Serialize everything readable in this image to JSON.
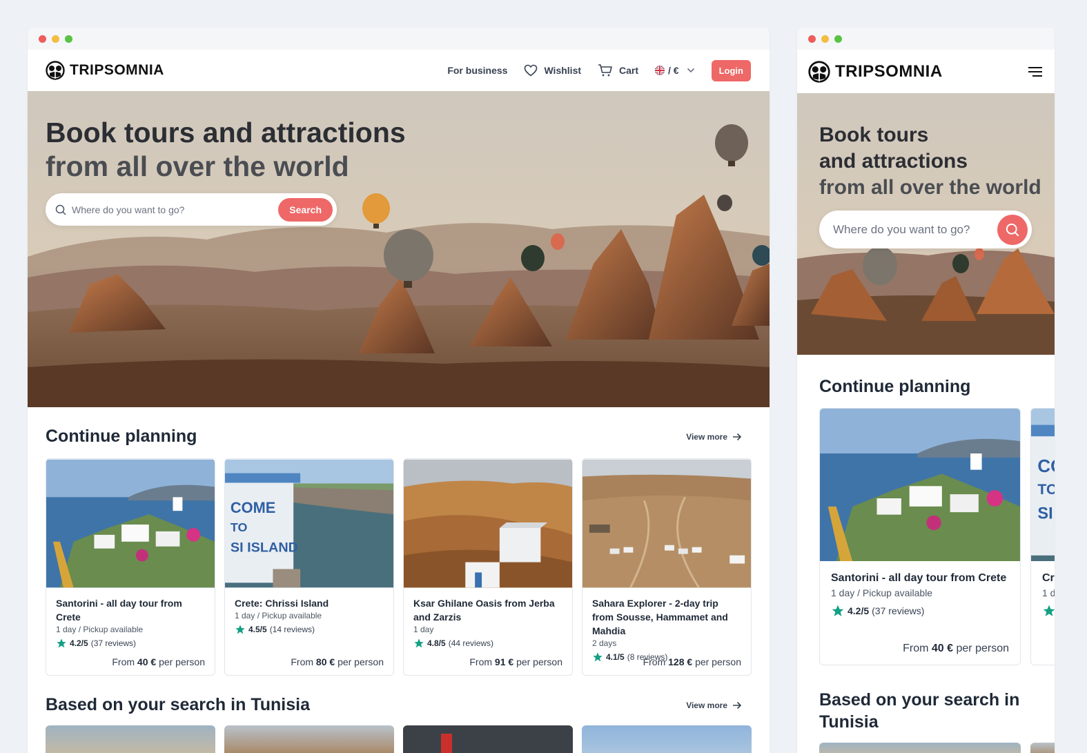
{
  "brand": {
    "name": "TRIPSOMNIA"
  },
  "nav": {
    "for_business": "For business",
    "wishlist": "Wishlist",
    "cart": "Cart",
    "lang_currency": "/ €",
    "login": "Login"
  },
  "hero": {
    "title_line1": "Book tours and attractions",
    "title_line2": "from all over the world",
    "mobile_title_line1": "Book tours",
    "mobile_title_line2": "and attractions",
    "mobile_title_line3": "from all over the world",
    "search_placeholder": "Where do you want to go?",
    "search_button": "Search"
  },
  "sections": {
    "continue_planning": {
      "title": "Continue planning",
      "view_more": "View more"
    },
    "based_on_search": {
      "title": "Based on your search in Tunisia",
      "view_more": "View more",
      "mobile_title_line1": "Based on your search in",
      "mobile_title_line2": "Tunisia"
    }
  },
  "cards": [
    {
      "title": "Santorini - all day tour from Crete",
      "subtitle": "1 day / Pickup available",
      "rating": "4.2/5",
      "reviews": "(37 reviews)",
      "price_prefix": "From",
      "price": "40 €",
      "price_suffix": "per person"
    },
    {
      "title": "Crete: Chrissi Island",
      "subtitle": "1 day / Pickup available",
      "rating": "4.5/5",
      "reviews": "(14 reviews)",
      "price_prefix": "From",
      "price": "80 €",
      "price_suffix": "per person"
    },
    {
      "title": "Ksar Ghilane Oasis from Jerba and Zarzis",
      "subtitle": "1 day",
      "rating": "4.8/5",
      "reviews": "(44 reviews)",
      "price_prefix": "From",
      "price": "91 €",
      "price_suffix": "per person"
    },
    {
      "title": "Sahara Explorer - 2-day trip from Sousse, Hammamet and Mahdia",
      "subtitle": "2 days",
      "rating": "4.1/5",
      "reviews": "(8 reviews)",
      "price_prefix": "From",
      "price": "128 €",
      "price_suffix": "per person"
    }
  ],
  "mobile_peek": {
    "title": "Cr",
    "subtitle": "1 d"
  },
  "colors": {
    "accent": "#ee6867",
    "star": "#14a085",
    "text": "#1f2937"
  }
}
